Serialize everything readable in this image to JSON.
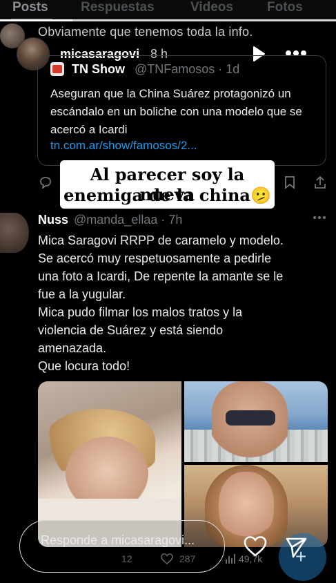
{
  "tabs": [
    "Posts",
    "Respuestas",
    "Videos",
    "Fotos"
  ],
  "previous_tweet_text": "Obviamente que tenemos toda la info.",
  "story": {
    "username": "micasaragovi",
    "time": "8 h"
  },
  "quoted_tweet": {
    "name": "TN Show",
    "handle": "@TNFamosos · 1d",
    "logo_text": "TN",
    "text": "Aseguran que la China Suárez protagonizó un escándalo en un boliche con una modelo que se acercó a Icardi",
    "link": "tn.com.ar/show/famosos/2..."
  },
  "sticker": {
    "line1": "Al parecer soy la nueva",
    "line2": "enemiga de la china",
    "emoji": "🫤"
  },
  "tweet": {
    "name": "Nuss",
    "handle": "@manda_ellaa · 7h",
    "lines": [
      "Mica Saragovi RRPP de caramelo y modelo.",
      "Se acercó muy respetuosamente a pedirle",
      "una foto a Icardi, De repente la amante se le",
      "fue a la yugular.",
      "Mica pudo filmar los malos tratos y la",
      "violencia de Suárez   y está siendo",
      "amenazada.",
      "Que locura todo!"
    ],
    "stats": {
      "replies": "12",
      "likes": "287",
      "views": "49,7k"
    }
  },
  "reply_bar": {
    "placeholder": "Responde a micasaragovi..."
  },
  "colors": {
    "background": "#000000",
    "link": "#1d9bf0",
    "muted": "#71767b"
  }
}
